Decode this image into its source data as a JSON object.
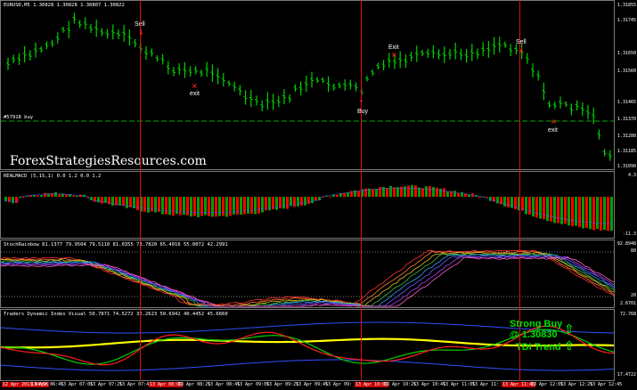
{
  "main": {
    "header": "EURUSD,M5  1.30828 1.30828 1.30807 1.30822",
    "watermark": "ForexStrategiesResources.com",
    "line_label": "#57918 buy",
    "scale": [
      "1.31855",
      "1.31745",
      "1.31650",
      "1.31560",
      "1.31465",
      "1.31370",
      "1.31280",
      "1.31185",
      "1.31090"
    ],
    "signals": {
      "sell1": "Sell",
      "exit1": "exit",
      "buy": "Buy",
      "exit_top": "Exit",
      "sell2": "Sell",
      "exit2": "exit"
    }
  },
  "macd": {
    "header": "REALMACD (5,15,1) 0.0 1.2 0.0 1.2",
    "scale_top": "4.3",
    "scale_bottom": "-11.3"
  },
  "stoch": {
    "header": "StochRainbow 81.1377 79.9504 79.5110 81.0355 73.7820 65.4016 55.0072 42.2991",
    "scale_top": "92.8948",
    "scale_80": "80",
    "scale_20": "20",
    "scale_bottom": "2.6701"
  },
  "tdi": {
    "header": "Traders Dynamic Index Visual 50.7871 74.5272 32.2623 50.6942 40.4452 45.6660",
    "scale_top": "72.768",
    "scale_bottom": "17.4722",
    "strong_buy": "Strong Buy",
    "price": "@ 1.30830",
    "trend": "TDI Trend"
  },
  "time_axis": [
    {
      "t": "12 Apr 2013 04:55",
      "hl": true
    },
    {
      "t": "13 Apr 06:45",
      "hl": false
    },
    {
      "t": "13 Apr 07:05",
      "hl": false
    },
    {
      "t": "13 Apr 07:25",
      "hl": false
    },
    {
      "t": "13 Apr 07:45",
      "hl": false
    },
    {
      "t": "13 Apr 08:05",
      "hl": true
    },
    {
      "t": "13 Apr 08:25",
      "hl": false
    },
    {
      "t": "13 Apr 08:45",
      "hl": false
    },
    {
      "t": "13 Apr 09:05",
      "hl": false
    },
    {
      "t": "13 Apr 09:25",
      "hl": false
    },
    {
      "t": "13 Apr 09:45",
      "hl": false
    },
    {
      "t": "13 Apr 09:",
      "hl": false
    },
    {
      "t": "13 Apr 10:05",
      "hl": true
    },
    {
      "t": "13 Apr 10:25",
      "hl": false
    },
    {
      "t": "13 Apr 10:45",
      "hl": false
    },
    {
      "t": "13 Apr 11:05",
      "hl": false
    },
    {
      "t": "13 Apr 11:",
      "hl": false
    },
    {
      "t": "13 Apr 11:45",
      "hl": true
    },
    {
      "t": "13 Apr 12:05",
      "hl": false
    },
    {
      "t": "13 Apr 12:25",
      "hl": false
    },
    {
      "t": "13 Apr 12:45",
      "hl": false
    }
  ],
  "colors": {
    "candle": "#00d000",
    "bull": "#00a000",
    "bear": "#ff0000",
    "vline": "#d11111",
    "tdi_yellow": "#ffff00"
  }
}
